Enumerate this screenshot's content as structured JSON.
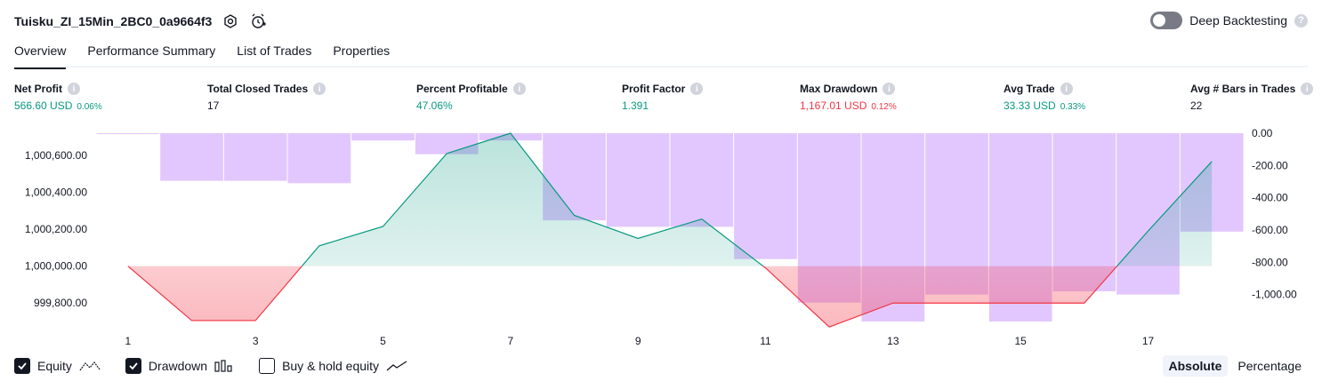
{
  "header": {
    "strategy_name": "Tuisku_ZI_15Min_2BC0_0a9664f3",
    "settings_icon": "settings-hexagon-icon",
    "add_alert_icon": "alarm-clock-plus-icon"
  },
  "deep_backtesting": {
    "label": "Deep Backtesting",
    "enabled": false,
    "help": "?"
  },
  "tabs": [
    {
      "label": "Overview",
      "active": true
    },
    {
      "label": "Performance Summary",
      "active": false
    },
    {
      "label": "List of Trades",
      "active": false
    },
    {
      "label": "Properties",
      "active": false
    }
  ],
  "metrics": [
    {
      "label": "Net Profit",
      "value": "566.60 USD",
      "pct": "0.06%",
      "color": "green"
    },
    {
      "label": "Total Closed Trades",
      "value": "17",
      "pct": "",
      "color": "dark"
    },
    {
      "label": "Percent Profitable",
      "value": "47.06%",
      "pct": "",
      "color": "green"
    },
    {
      "label": "Profit Factor",
      "value": "1.391",
      "pct": "",
      "color": "green"
    },
    {
      "label": "Max Drawdown",
      "value": "1,167.01 USD",
      "pct": "0.12%",
      "color": "red"
    },
    {
      "label": "Avg Trade",
      "value": "33.33 USD",
      "pct": "0.33%",
      "color": "green"
    },
    {
      "label": "Avg # Bars in Trades",
      "value": "22",
      "pct": "",
      "color": "dark"
    }
  ],
  "info_glyph": "i",
  "chart_data": {
    "type": "line",
    "equity_axis": {
      "ticks": [
        "1,000,600.00",
        "1,000,400.00",
        "1,000,200.00",
        "1,000,000.00",
        "999,800.00"
      ],
      "tick_values": [
        1000600,
        1000400,
        1000200,
        1000000,
        999800
      ],
      "range": [
        999700,
        1000720
      ]
    },
    "drawdown_axis": {
      "ticks": [
        "0.00",
        "-200.00",
        "-400.00",
        "-600.00",
        "-800.00",
        "-1,000.00"
      ],
      "tick_values": [
        0,
        -200,
        -400,
        -600,
        -800,
        -1000
      ],
      "range": [
        -1167,
        0
      ]
    },
    "x_ticks": [
      "1",
      "3",
      "5",
      "7",
      "9",
      "11",
      "13",
      "15",
      "17"
    ],
    "x_tick_values": [
      1,
      3,
      5,
      7,
      9,
      11,
      13,
      15,
      17
    ],
    "x_range": [
      0.5,
      18.5
    ],
    "equity": {
      "x": [
        1,
        2,
        3,
        4,
        5,
        6,
        7,
        8,
        9,
        10,
        11,
        12,
        13,
        14,
        15,
        16,
        17,
        18
      ],
      "values": [
        1000000,
        999705,
        999705,
        1000110,
        1000215,
        1000610,
        1000720,
        1000275,
        1000150,
        1000255,
        999990,
        999670,
        999800,
        999800,
        999800,
        999800,
        1000190,
        1000567
      ]
    },
    "drawdown": {
      "x": [
        1,
        2,
        3,
        4,
        5,
        6,
        7,
        8,
        9,
        10,
        11,
        12,
        13,
        14,
        15,
        16,
        17,
        18
      ],
      "values": [
        -5,
        -295,
        -295,
        -310,
        -45,
        -130,
        -45,
        -540,
        -580,
        -580,
        -780,
        -1050,
        -1167,
        -1000,
        -1167,
        -980,
        -1000,
        -610
      ]
    },
    "colors": {
      "equity_up": "#089981",
      "equity_down": "#f23645",
      "drawdown": "#d8b4fe",
      "grid": "#f0f3fa"
    }
  },
  "legend": [
    {
      "label": "Equity",
      "checked": true,
      "icon": "equity-line-icon"
    },
    {
      "label": "Drawdown",
      "checked": true,
      "icon": "drawdown-bars-icon"
    },
    {
      "label": "Buy & hold equity",
      "checked": false,
      "icon": "buy-hold-line-icon"
    }
  ],
  "modes": [
    {
      "label": "Absolute",
      "active": true
    },
    {
      "label": "Percentage",
      "active": false
    }
  ]
}
